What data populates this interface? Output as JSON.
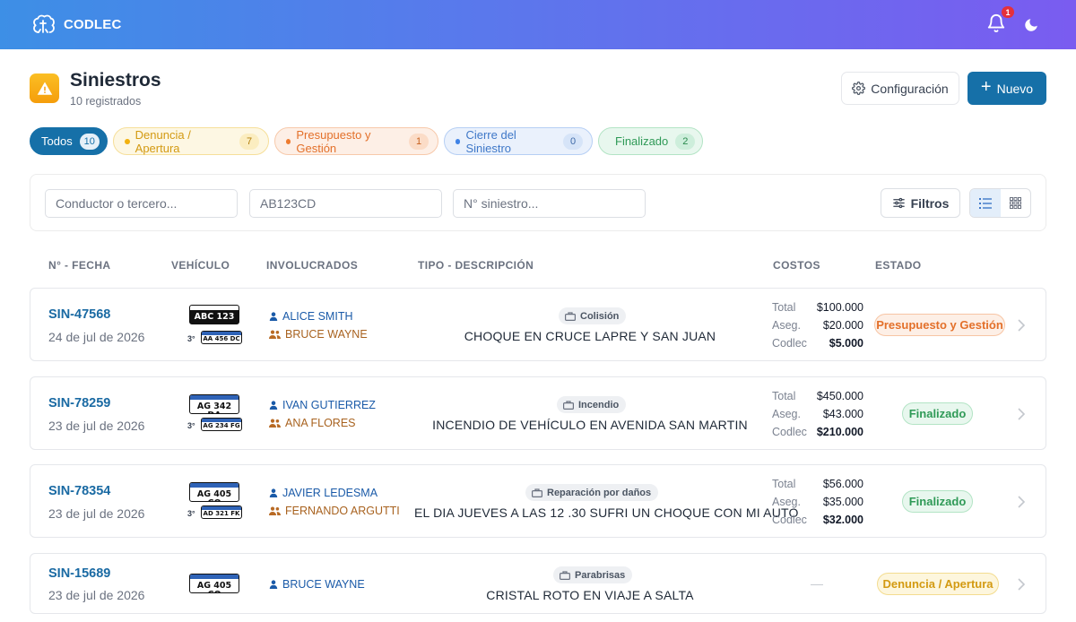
{
  "app": {
    "name": "CODLEC",
    "notifications": "1"
  },
  "header": {
    "title": "Siniestros",
    "subtitle": "10 registrados",
    "config_label": "Configuración",
    "new_label": "Nuevo"
  },
  "tabs": [
    {
      "label": "Todos",
      "count": "10"
    },
    {
      "label": "Denuncia / Apertura",
      "count": "7"
    },
    {
      "label": "Presupuesto y Gestión",
      "count": "1"
    },
    {
      "label": "Cierre del Siniestro",
      "count": "0"
    },
    {
      "label": "Finalizado",
      "count": "2"
    }
  ],
  "filters": {
    "conductor_placeholder": "Conductor o tercero...",
    "plate_placeholder": "AB123CD",
    "sin_placeholder": "N° siniestro...",
    "filter_label": "Filtros"
  },
  "columns": [
    "N° - FECHA",
    "VEHÍCULO",
    "INVOLUCRADOS",
    "TIPO - DESCRIPCIÓN",
    "COSTOS",
    "ESTADO"
  ],
  "cost_labels": {
    "total": "Total",
    "aseg": "Aseg.",
    "codlec": "Codlec"
  },
  "rows": [
    {
      "number": "SIN-47568",
      "date": "24 de jul de 2026",
      "plate": "ABC 123",
      "third_label": "3°",
      "third_plate": "AA 456 DC",
      "person1": "ALICE SMITH",
      "person2": "BRUCE WAYNE",
      "type": "Colisión",
      "description": "CHOQUE EN CRUCE LAPRE Y SAN JUAN",
      "total": "$100.000",
      "aseg": "$20.000",
      "codlec": "$5.000",
      "status": "Presupuesto y Gestión"
    },
    {
      "number": "SIN-78259",
      "date": "23 de jul de 2026",
      "plate": "AG 342 DA",
      "third_label": "3°",
      "third_plate": "AG 234 FG",
      "person1": "IVAN GUTIERREZ",
      "person2": "ANA FLORES",
      "type": "Incendio",
      "description": "INCENDIO DE VEHÍCULO EN AVENIDA SAN MARTIN",
      "total": "$450.000",
      "aseg": "$43.000",
      "codlec": "$210.000",
      "status": "Finalizado"
    },
    {
      "number": "SIN-78354",
      "date": "23 de jul de 2026",
      "plate": "AG 405 CQ",
      "third_label": "3°",
      "third_plate": "AD 321 FK",
      "person1": "JAVIER LEDESMA",
      "person2": "FERNANDO ARGUTTI",
      "type": "Reparación por daños",
      "description": "EL DIA JUEVES A LAS 12 .30 SUFRI UN CHOQUE CON MI AUTO",
      "total": "$56.000",
      "aseg": "$35.000",
      "codlec": "$32.000",
      "status": "Finalizado"
    },
    {
      "number": "SIN-15689",
      "date": "23 de jul de 2026",
      "plate": "AG 405 CQ",
      "person1": "BRUCE WAYNE",
      "type": "Parabrisas",
      "description": "CRISTAL ROTO EN VIAJE A SALTA",
      "status": "Denuncia / Apertura"
    }
  ]
}
